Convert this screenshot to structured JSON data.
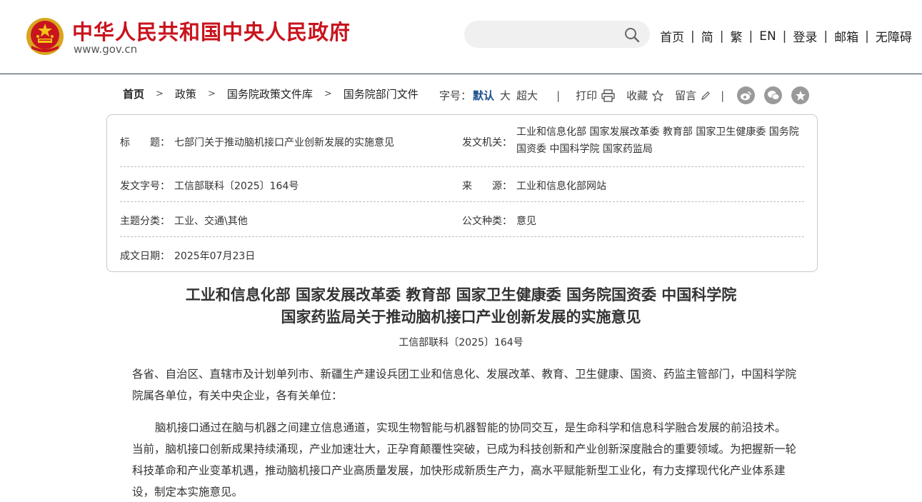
{
  "header": {
    "site_name": "中华人民共和国中央人民政府",
    "site_url": "www.gov.cn",
    "search_placeholder": "",
    "nav": [
      "首页",
      "简",
      "繁",
      "EN",
      "登录",
      "邮箱",
      "无障碍"
    ],
    "brand_color": "#c8141e"
  },
  "breadcrumb": {
    "items": [
      "首页",
      "政策",
      "国务院政策文件库",
      "国务院部门文件"
    ]
  },
  "tools": {
    "font_size_label": "字号：",
    "font_sizes": [
      "默认",
      "大",
      "超大"
    ],
    "active_font_size": "默认",
    "print": "打印",
    "favorite": "收藏",
    "comment": "留言",
    "share_icons": [
      "weibo-icon",
      "wechat-icon",
      "qzone-icon"
    ]
  },
  "info": {
    "title_label": "标　　题：",
    "title_value": "七部门关于推动脑机接口产业创新发展的实施意见",
    "issuer_label": "发文机关：",
    "issuer_value": "工业和信息化部 国家发展改革委 教育部 国家卫生健康委 国务院国资委 中国科学院 国家药监局",
    "doc_no_label": "发文字号：",
    "doc_no_value": "工信部联科〔2025〕164号",
    "source_label": "来　　源：",
    "source_value": "工业和信息化部网站",
    "topic_label": "主题分类：",
    "topic_value": "工业、交通\\其他",
    "type_label": "公文种类：",
    "type_value": "意见",
    "date_label": "成文日期：",
    "date_value": "2025年07月23日"
  },
  "article": {
    "title_line1": "工业和信息化部 国家发展改革委 教育部 国家卫生健康委 国务院国资委 中国科学院",
    "title_line2": "国家药监局关于推动脑机接口产业创新发展的实施意见",
    "doc_number": "工信部联科〔2025〕164号",
    "paragraph1": "各省、自治区、直辖市及计划单列市、新疆生产建设兵团工业和信息化、发展改革、教育、卫生健康、国资、药监主管部门，中国科学院院属各单位，有关中央企业，各有关单位：",
    "paragraph2": "脑机接口通过在脑与机器之间建立信息通道，实现生物智能与机器智能的协同交互，是生命科学和信息科学融合发展的前沿技术。当前，脑机接口创新成果持续涌现，产业加速壮大，正孕育颠覆性突破，已成为科技创新和产业创新深度融合的重要领域。为把握新一轮科技革命和产业变革机遇，推动脑机接口产业高质量发展，加快形成新质生产力，高水平赋能新型工业化，有力支撑现代化产业体系建设，制定本实施意见。"
  }
}
